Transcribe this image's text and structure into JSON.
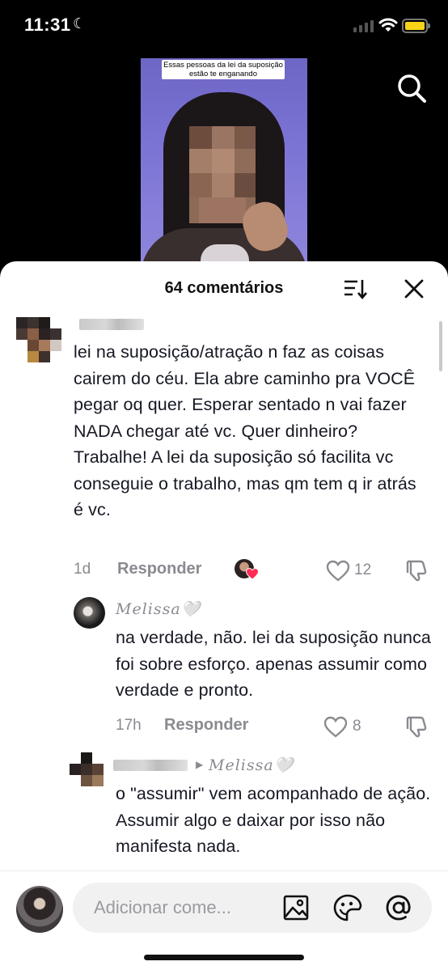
{
  "status_bar": {
    "time": "11:31",
    "moon_icon": "moon-icon",
    "battery_color": "#f7d417"
  },
  "video": {
    "caption": "Essas pessoas da lei da suposição estão te enganando"
  },
  "comments_panel": {
    "title": "64 comentários",
    "sort_icon": "sort-icon",
    "close_icon": "close-icon"
  },
  "comments": [
    {
      "text": "lei na suposição/atração n faz as coisas cairem do céu. Ela abre caminho pra VOCÊ pegar oq quer. Esperar sentado n vai fazer NADA chegar até vc. Quer dinheiro? Trabalhe! A lei da suposição só facilita vc conseguie o trabalho, mas qm tem q ir atrás é vc.",
      "age": "1d",
      "reply_label": "Responder",
      "likes": "12"
    },
    {
      "username": "𝑀𝑒𝑙𝑖𝑠𝑠𝑎🤍",
      "text": "na verdade, não. lei da suposição nunca foi sobre esforço. apenas assumir como verdade e pronto.",
      "age": "17h",
      "reply_label": "Responder",
      "likes": "8"
    },
    {
      "reply_to": "𝑀𝑒𝑙𝑖𝑠𝑠𝑎🤍",
      "text": "o \"assumir\" vem acompanhado de ação. Assumir algo e daixar por isso não manifesta nada."
    }
  ],
  "composer": {
    "placeholder": "Adicionar come..."
  },
  "colors": {
    "heart_badge": "#fe2c55",
    "muted_text": "#8a8b91"
  }
}
